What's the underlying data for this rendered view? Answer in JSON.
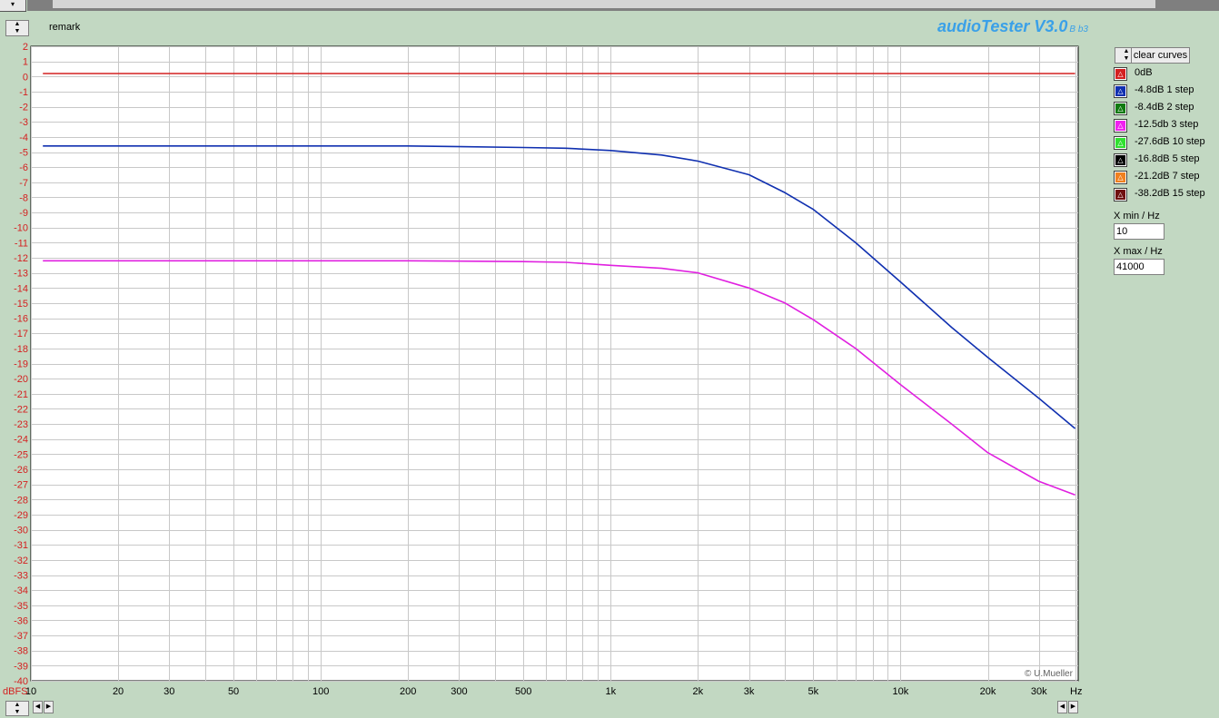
{
  "app": {
    "remark": "remark",
    "brand": "audioTester V3.0",
    "brand_version": "B b3",
    "copyright": "© U.Mueller"
  },
  "controls": {
    "clear_curves_label": "clear curves",
    "xmin_label": "X min / Hz",
    "xmin_value": "10",
    "xmax_label": "X max / Hz",
    "xmax_value": "41000"
  },
  "legend": [
    {
      "label": "0dB",
      "color": "#d42020"
    },
    {
      "label": "-4.8dB 1 step",
      "color": "#1030b0"
    },
    {
      "label": "-8.4dB 2 step",
      "color": "#107a10"
    },
    {
      "label": "-12.5db 3 step",
      "color": "#f020f0"
    },
    {
      "label": "-27.6dB 10 step",
      "color": "#30e030"
    },
    {
      "label": "-16.8dB 5 step",
      "color": "#000000"
    },
    {
      "label": "-21.2dB 7 step",
      "color": "#f08020"
    },
    {
      "label": "-38.2dB 15 step",
      "color": "#701010"
    }
  ],
  "chart_data": {
    "type": "line",
    "x_scale": "log",
    "xlim": [
      10,
      41000
    ],
    "ylim": [
      -40,
      2
    ],
    "ylabel": "dBFS",
    "xunit": "Hz",
    "x_ticks": [
      10,
      20,
      30,
      50,
      100,
      200,
      300,
      500,
      1000,
      2000,
      3000,
      5000,
      10000,
      20000,
      30000
    ],
    "x_tick_labels": [
      "10",
      "20",
      "30",
      "50",
      "100",
      "200",
      "300",
      "500",
      "1k",
      "2k",
      "3k",
      "5k",
      "10k",
      "20k",
      "30k"
    ],
    "y_ticks": [
      2,
      1,
      0,
      -1,
      -2,
      -3,
      -4,
      -5,
      -6,
      -7,
      -8,
      -9,
      -10,
      -11,
      -12,
      -13,
      -14,
      -15,
      -16,
      -17,
      -18,
      -19,
      -20,
      -21,
      -22,
      -23,
      -24,
      -25,
      -26,
      -27,
      -28,
      -29,
      -30,
      -31,
      -32,
      -33,
      -34,
      -35,
      -36,
      -37,
      -38,
      -39,
      -40
    ],
    "grid": true,
    "series": [
      {
        "name": "0dB",
        "color": "#d42020",
        "x": [
          11,
          20,
          50,
          100,
          200,
          500,
          1000,
          2000,
          5000,
          10000,
          20000,
          40000
        ],
        "y": [
          0.2,
          0.2,
          0.2,
          0.2,
          0.2,
          0.2,
          0.2,
          0.2,
          0.2,
          0.2,
          0.2,
          0.2
        ]
      },
      {
        "name": "-4.8dB 1 step",
        "color": "#1030b0",
        "x": [
          11,
          20,
          50,
          100,
          200,
          500,
          700,
          1000,
          1500,
          2000,
          3000,
          4000,
          5000,
          7000,
          10000,
          15000,
          20000,
          30000,
          40000
        ],
        "y": [
          -4.6,
          -4.6,
          -4.6,
          -4.6,
          -4.6,
          -4.7,
          -4.75,
          -4.9,
          -5.2,
          -5.6,
          -6.5,
          -7.7,
          -8.8,
          -11.0,
          -13.6,
          -16.6,
          -18.6,
          -21.3,
          -23.3
        ]
      },
      {
        "name": "-12.5db 3 step",
        "color": "#e020e0",
        "x": [
          11,
          20,
          50,
          100,
          200,
          500,
          700,
          1000,
          1500,
          2000,
          3000,
          4000,
          5000,
          7000,
          10000,
          15000,
          20000,
          30000,
          40000
        ],
        "y": [
          -12.2,
          -12.2,
          -12.2,
          -12.2,
          -12.2,
          -12.25,
          -12.3,
          -12.5,
          -12.7,
          -13.0,
          -14.0,
          -15.0,
          -16.1,
          -18.0,
          -20.4,
          -23.0,
          -24.9,
          -26.8,
          -27.7
        ]
      }
    ]
  }
}
